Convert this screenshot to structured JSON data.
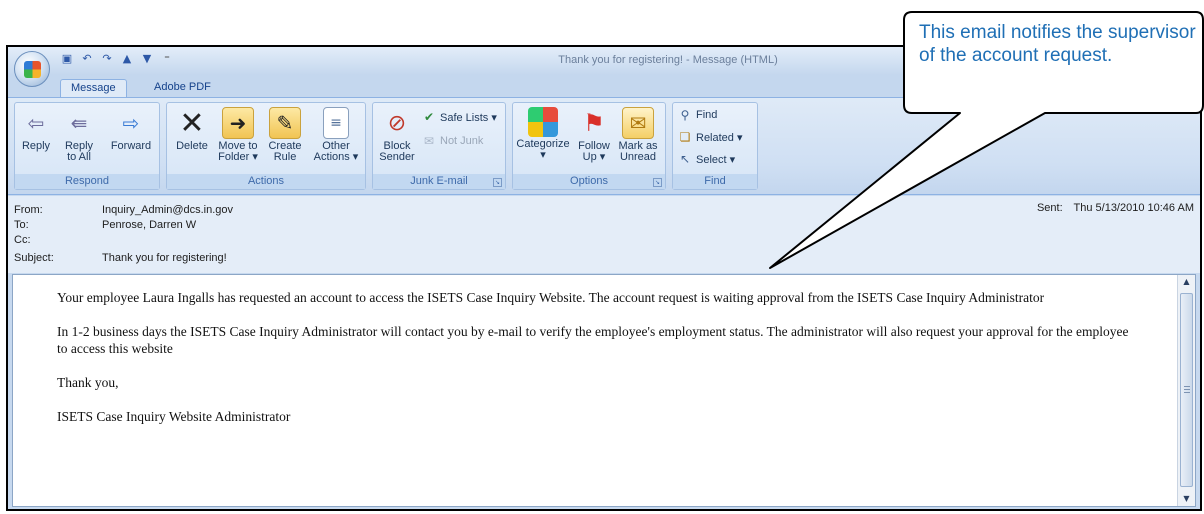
{
  "window": {
    "title": "Thank you for registering! - Message (HTML)"
  },
  "tabs": [
    {
      "label": "Message",
      "active": true
    },
    {
      "label": "Adobe PDF",
      "active": false
    }
  ],
  "ribbon": {
    "respond": {
      "group_label": "Respond",
      "reply": "Reply",
      "reply_all": "Reply\nto All",
      "forward": "Forward"
    },
    "actions": {
      "group_label": "Actions",
      "delete": "Delete",
      "move_to_folder": "Move to\nFolder ▾",
      "create_rule": "Create\nRule",
      "other_actions": "Other\nActions ▾"
    },
    "junk": {
      "group_label": "Junk E-mail",
      "block_sender": "Block\nSender",
      "safe_lists": "Safe Lists ▾",
      "not_junk": "Not Junk"
    },
    "options": {
      "group_label": "Options",
      "categorize": "Categorize\n▾",
      "follow_up": "Follow\nUp ▾",
      "mark_as_unread": "Mark as\nUnread"
    },
    "find": {
      "group_label": "Find",
      "find": "Find",
      "related": "Related ▾",
      "select": "Select ▾"
    }
  },
  "header": {
    "from_label": "From:",
    "from_value": "Inquiry_Admin@dcs.in.gov",
    "to_label": "To:",
    "to_value": "Penrose, Darren W",
    "cc_label": "Cc:",
    "cc_value": "",
    "subject_label": "Subject:",
    "subject_value": "Thank you for registering!",
    "sent_label": "Sent:",
    "sent_value": "Thu 5/13/2010 10:46 AM"
  },
  "body": {
    "paragraphs": [
      "Your employee Laura Ingalls has requested an account to access the ISETS Case Inquiry Website. The account request is waiting approval from the ISETS Case Inquiry Administrator",
      "In 1-2 business days the ISETS Case Inquiry Administrator will contact you by e-mail to verify the employee's employment status. The administrator will also request your approval for the employee to access this website",
      "Thank you,",
      "ISETS Case Inquiry Website Administrator"
    ]
  },
  "callout": {
    "text": "This email notifies the supervisor of the account request."
  },
  "colors": {
    "callout_text": "#1f6fb5",
    "ribbon_text": "#1e395b",
    "tab_text": "#15428b"
  }
}
